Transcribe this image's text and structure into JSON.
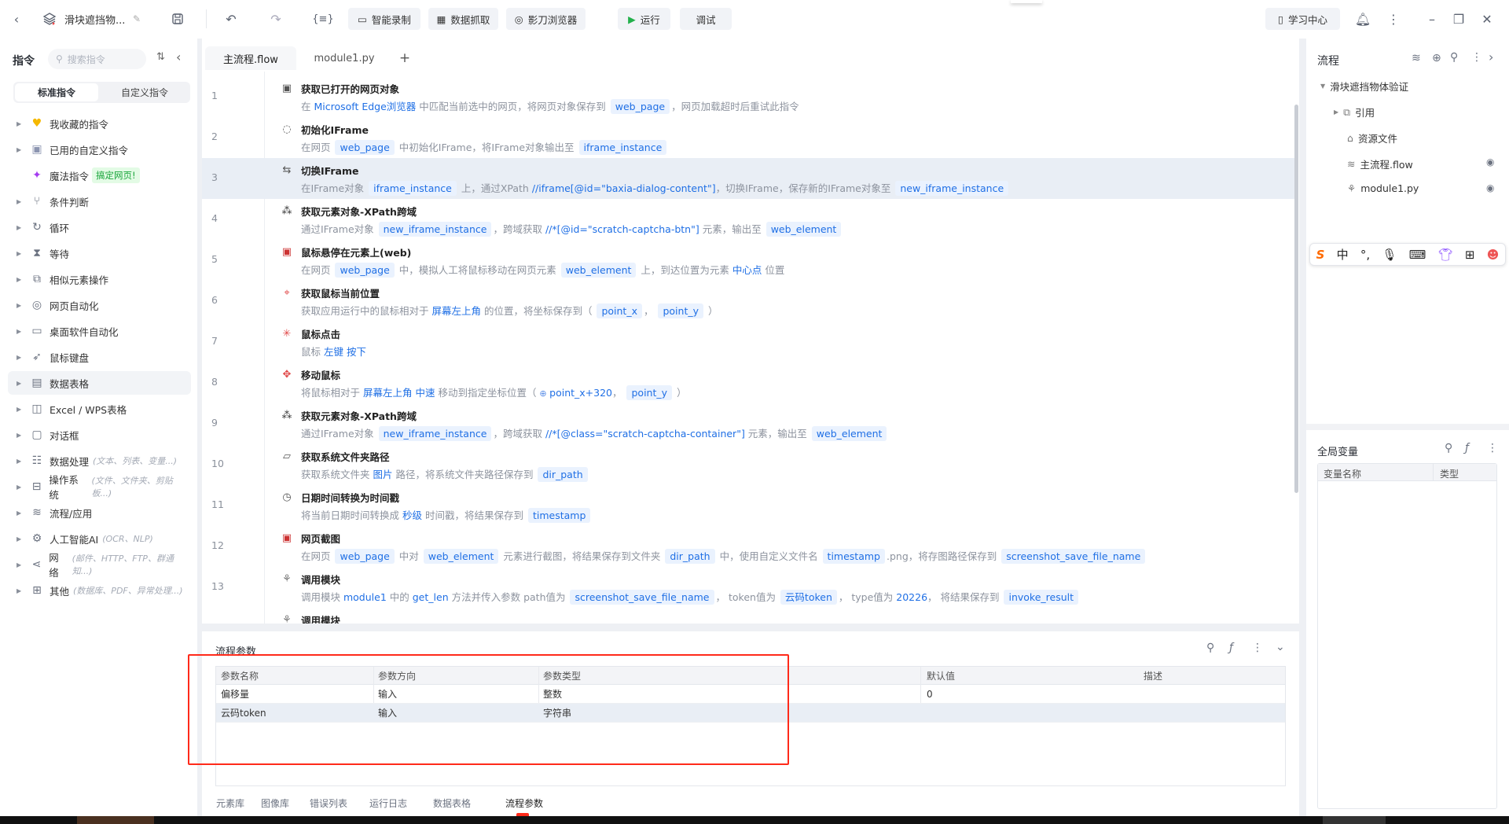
{
  "topbar": {
    "title": "滑块遮挡物...",
    "buttons": {
      "record": "智能录制",
      "scrape": "数据抓取",
      "browser": "影刀浏览器",
      "run": "运行",
      "debug": "调试"
    },
    "learn": "学习中心"
  },
  "sidebar": {
    "title": "指令",
    "search_placeholder": "搜索指令",
    "tabs": [
      "标准指令",
      "自定义指令"
    ],
    "items": [
      {
        "label": "我收藏的指令",
        "icon": "heart-icon",
        "caret": true
      },
      {
        "label": "已用的自定义指令",
        "icon": "calendar-icon",
        "caret": true
      },
      {
        "label": "魔法指令",
        "icon": "sparkle-icon",
        "caret": false,
        "badge": "搞定网页!"
      },
      {
        "label": "条件判断",
        "icon": "branch-icon",
        "caret": true
      },
      {
        "label": "循环",
        "icon": "loop-icon",
        "caret": true
      },
      {
        "label": "等待",
        "icon": "hourglass-icon",
        "caret": true
      },
      {
        "label": "相似元素操作",
        "icon": "copy-icon",
        "caret": true
      },
      {
        "label": "网页自动化",
        "icon": "browser-icon",
        "caret": true
      },
      {
        "label": "桌面软件自动化",
        "icon": "monitor-icon",
        "caret": true
      },
      {
        "label": "鼠标键盘",
        "icon": "cursor-icon",
        "caret": true
      },
      {
        "label": "数据表格",
        "icon": "document-icon",
        "caret": true,
        "active": true
      },
      {
        "label": "Excel / WPS表格",
        "icon": "excel-icon",
        "caret": true
      },
      {
        "label": "对话框",
        "icon": "dialog-icon",
        "caret": true
      },
      {
        "label": "数据处理",
        "icon": "data-process-icon",
        "caret": true,
        "hint": "(文本、列表、变量...)"
      },
      {
        "label": "操作系统",
        "icon": "briefcase-icon",
        "caret": true,
        "hint": "(文件、文件夹、剪贴板...)"
      },
      {
        "label": "流程/应用",
        "icon": "layers-icon",
        "caret": true
      },
      {
        "label": "人工智能AI",
        "icon": "ai-icon",
        "caret": true,
        "hint": "(OCR、NLP)"
      },
      {
        "label": "网络",
        "icon": "share-icon",
        "caret": true,
        "hint": "(邮件、HTTP、FTP、群通知...)"
      },
      {
        "label": "其他",
        "icon": "grid-icon",
        "caret": true,
        "hint": "(数据库、PDF、异常处理...)"
      }
    ]
  },
  "editor": {
    "tabs": [
      "主流程.flow",
      "module1.py"
    ],
    "rows": [
      {
        "num": "1",
        "title": "获取已打开的网页对象",
        "icon": "webpage-icon",
        "desc": [
          {
            "k": "p",
            "t": "在 "
          },
          {
            "k": "l",
            "t": "Microsoft Edge浏览器"
          },
          {
            "k": "p",
            "t": " 中匹配当前选中的网页，将网页对象保存到 "
          },
          {
            "k": "v",
            "t": "web_page"
          },
          {
            "k": "p",
            "t": "，网页加载超时后重试此指令"
          }
        ]
      },
      {
        "num": "2",
        "title": "初始化IFrame",
        "icon": "iframe-init-icon",
        "desc": [
          {
            "k": "p",
            "t": "在网页 "
          },
          {
            "k": "v",
            "t": "web_page"
          },
          {
            "k": "p",
            "t": " 中初始化IFrame，将IFrame对象输出至 "
          },
          {
            "k": "v",
            "t": "iframe_instance"
          }
        ]
      },
      {
        "num": "3",
        "title": "切换IFrame",
        "icon": "switch-icon",
        "selected": true,
        "desc": [
          {
            "k": "p",
            "t": "在IFrame对象 "
          },
          {
            "k": "v",
            "t": "iframe_instance"
          },
          {
            "k": "p",
            "t": " 上，通过XPath "
          },
          {
            "k": "l",
            "t": "//iframe[@id=\"baxia-dialog-content\"]"
          },
          {
            "k": "p",
            "t": "，切换IFrame，保存新的IFrame对象至 "
          },
          {
            "k": "v",
            "t": "new_iframe_instance"
          }
        ]
      },
      {
        "num": "4",
        "title": "获取元素对象-XPath跨域",
        "icon": "element-icon",
        "desc": [
          {
            "k": "p",
            "t": "通过IFrame对象 "
          },
          {
            "k": "v",
            "t": "new_iframe_instance"
          },
          {
            "k": "p",
            "t": "，跨域获取 "
          },
          {
            "k": "l",
            "t": "//*[@id=\"scratch-captcha-btn\"]"
          },
          {
            "k": "p",
            "t": " 元素，输出至 "
          },
          {
            "k": "v",
            "t": "web_element"
          }
        ]
      },
      {
        "num": "5",
        "title": "鼠标悬停在元素上(web)",
        "icon": "hover-icon",
        "desc": [
          {
            "k": "p",
            "t": "在网页 "
          },
          {
            "k": "v",
            "t": "web_page"
          },
          {
            "k": "p",
            "t": " 中，模拟人工将鼠标移动在网页元素 "
          },
          {
            "k": "v",
            "t": "web_element"
          },
          {
            "k": "p",
            "t": " 上，到达位置为元素 "
          },
          {
            "k": "l",
            "t": "中心点"
          },
          {
            "k": "p",
            "t": " 位置"
          }
        ]
      },
      {
        "num": "6",
        "title": "获取鼠标当前位置",
        "icon": "mouse-position-icon",
        "desc": [
          {
            "k": "p",
            "t": "获取应用运行中的鼠标相对于 "
          },
          {
            "k": "l",
            "t": "屏幕左上角"
          },
          {
            "k": "p",
            "t": " 的位置，将坐标保存到（ "
          },
          {
            "k": "v",
            "t": "point_x"
          },
          {
            "k": "p",
            "t": "， "
          },
          {
            "k": "v",
            "t": "point_y"
          },
          {
            "k": "p",
            "t": " ）"
          }
        ]
      },
      {
        "num": "7",
        "title": "鼠标点击",
        "icon": "mouse-click-icon",
        "desc": [
          {
            "k": "p",
            "t": "鼠标 "
          },
          {
            "k": "l",
            "t": "左键 按下"
          }
        ]
      },
      {
        "num": "8",
        "title": "移动鼠标",
        "icon": "mouse-move-icon",
        "desc": [
          {
            "k": "p",
            "t": "将鼠标相对于 "
          },
          {
            "k": "l",
            "t": "屏幕左上角 中速"
          },
          {
            "k": "p",
            "t": " 移动到指定坐标位置（ "
          },
          {
            "k": "e",
            "t": "point_x+320"
          },
          {
            "k": "p",
            "t": "， "
          },
          {
            "k": "v",
            "t": "point_y"
          },
          {
            "k": "p",
            "t": " ）"
          }
        ]
      },
      {
        "num": "9",
        "title": "获取元素对象-XPath跨域",
        "icon": "element-icon",
        "desc": [
          {
            "k": "p",
            "t": "通过IFrame对象 "
          },
          {
            "k": "v",
            "t": "new_iframe_instance"
          },
          {
            "k": "p",
            "t": "，跨域获取 "
          },
          {
            "k": "l",
            "t": "//*[@class=\"scratch-captcha-container\"]"
          },
          {
            "k": "p",
            "t": " 元素，输出至 "
          },
          {
            "k": "v",
            "t": "web_element"
          }
        ]
      },
      {
        "num": "10",
        "title": "获取系统文件夹路径",
        "icon": "folder-icon",
        "desc": [
          {
            "k": "p",
            "t": "获取系统文件夹 "
          },
          {
            "k": "l",
            "t": "图片"
          },
          {
            "k": "p",
            "t": " 路径，将系统文件夹路径保存到 "
          },
          {
            "k": "v",
            "t": "dir_path"
          }
        ]
      },
      {
        "num": "11",
        "title": "日期时间转换为时间戳",
        "icon": "clock-icon",
        "desc": [
          {
            "k": "p",
            "t": "将当前日期时间转换成 "
          },
          {
            "k": "l",
            "t": "秒级"
          },
          {
            "k": "p",
            "t": " 时间戳，将结果保存到 "
          },
          {
            "k": "v",
            "t": "timestamp"
          }
        ]
      },
      {
        "num": "12",
        "title": "网页截图",
        "icon": "screenshot-icon",
        "desc": [
          {
            "k": "p",
            "t": "在网页 "
          },
          {
            "k": "v",
            "t": "web_page"
          },
          {
            "k": "p",
            "t": " 中对 "
          },
          {
            "k": "v",
            "t": "web_element"
          },
          {
            "k": "p",
            "t": " 元素进行截图，将结果保存到文件夹 "
          },
          {
            "k": "v",
            "t": "dir_path"
          },
          {
            "k": "p",
            "t": " 中，使用自定义文件名 "
          },
          {
            "k": "v",
            "t": "timestamp"
          },
          {
            "k": "p",
            "t": ".png，将存图路径保存到 "
          },
          {
            "k": "v",
            "t": "screenshot_save_file_name"
          }
        ]
      },
      {
        "num": "13",
        "title": "调用模块",
        "icon": "python-icon",
        "desc": [
          {
            "k": "p",
            "t": "调用模块 "
          },
          {
            "k": "l",
            "t": "module1"
          },
          {
            "k": "p",
            "t": " 中的 "
          },
          {
            "k": "l",
            "t": "get_len"
          },
          {
            "k": "p",
            "t": " 方法并传入参数 path值为 "
          },
          {
            "k": "v",
            "t": "screenshot_save_file_name"
          },
          {
            "k": "p",
            "t": "， token值为 "
          },
          {
            "k": "v",
            "t": "云码token"
          },
          {
            "k": "p",
            "t": "， type值为 "
          },
          {
            "k": "l",
            "t": "20226"
          },
          {
            "k": "p",
            "t": "， 将结果保存到 "
          },
          {
            "k": "v",
            "t": "invoke_result"
          }
        ]
      },
      {
        "num": "",
        "title": "调用模块",
        "icon": "python-icon",
        "desc": []
      }
    ]
  },
  "right": {
    "title": "流程",
    "project": "滑块遮挡物体验证",
    "tree": [
      "引用",
      "资源文件",
      "主流程.flow",
      "module1.py"
    ],
    "ime_char": "中",
    "globals_title": "全局变量",
    "globals_columns": [
      "变量名称",
      "类型"
    ]
  },
  "bottom": {
    "title": "流程参数",
    "columns": [
      "参数名称",
      "参数方向",
      "参数类型",
      "默认值",
      "描述"
    ],
    "rows": [
      [
        "偏移量",
        "输入",
        "整数",
        "0",
        ""
      ],
      [
        "云码token",
        "输入",
        "字符串",
        "",
        ""
      ]
    ],
    "tabs": [
      "元素库",
      "图像库",
      "错误列表",
      "运行日志",
      "数据表格",
      "流程参数"
    ],
    "active_tab": 5
  },
  "colors": {
    "accent": "#1f6fe5",
    "annotation": "#ff2a1a",
    "run": "#22b04b"
  }
}
